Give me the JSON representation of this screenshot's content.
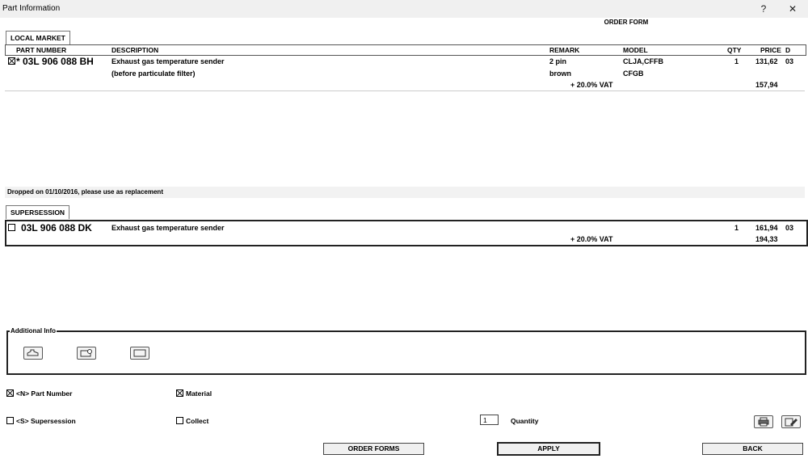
{
  "window": {
    "title": "Part Information",
    "help_glyph": "?",
    "close_glyph": "✕"
  },
  "header": {
    "order_form": "ORDER FORM"
  },
  "local_market": {
    "tab_label": "LOCAL MARKET",
    "columns": {
      "part_number": "PART NUMBER",
      "description": "DESCRIPTION",
      "remark": "REMARK",
      "model": "MODEL",
      "qty": "QTY",
      "price": "PRICE",
      "d": "D"
    },
    "row": {
      "checked": true,
      "part_number": "* 03L 906 088 BH",
      "description_1": "Exhaust gas temperature sender",
      "description_2": "(before particulate filter)",
      "remark_1": "2 pin",
      "remark_2": "brown",
      "model_1": "CLJA,CFFB",
      "model_2": "CFGB",
      "qty": "1",
      "price": "131,62",
      "d": "03",
      "vat_label": "+ 20.0% VAT",
      "price_vat": "157,94"
    }
  },
  "dropped_note": "Dropped on 01/10/2016, please use as replacement",
  "supersession": {
    "tab_label": "SUPERSESSION",
    "row": {
      "checked": false,
      "part_number": "03L 906 088 DK",
      "description": "Exhaust gas temperature sender",
      "qty": "1",
      "price": "161,94",
      "d": "03",
      "vat_label": "+ 20.0% VAT",
      "price_vat": "194,33"
    }
  },
  "additional_info": {
    "title": "Additional Info",
    "icons": [
      "engine-icon",
      "camera-icon",
      "book-icon"
    ]
  },
  "options": {
    "part_number_label": "<N> Part Number",
    "part_number_checked": true,
    "material_label": "Material",
    "material_checked": true,
    "supersession_label": "<S> Supersession",
    "supersession_checked": false,
    "collect_label": "Collect",
    "collect_checked": false,
    "quantity_value": "1",
    "quantity_label": "Quantity"
  },
  "buttons": {
    "order_forms": "ORDER FORMS",
    "apply": "APPLY",
    "back": "BACK"
  }
}
